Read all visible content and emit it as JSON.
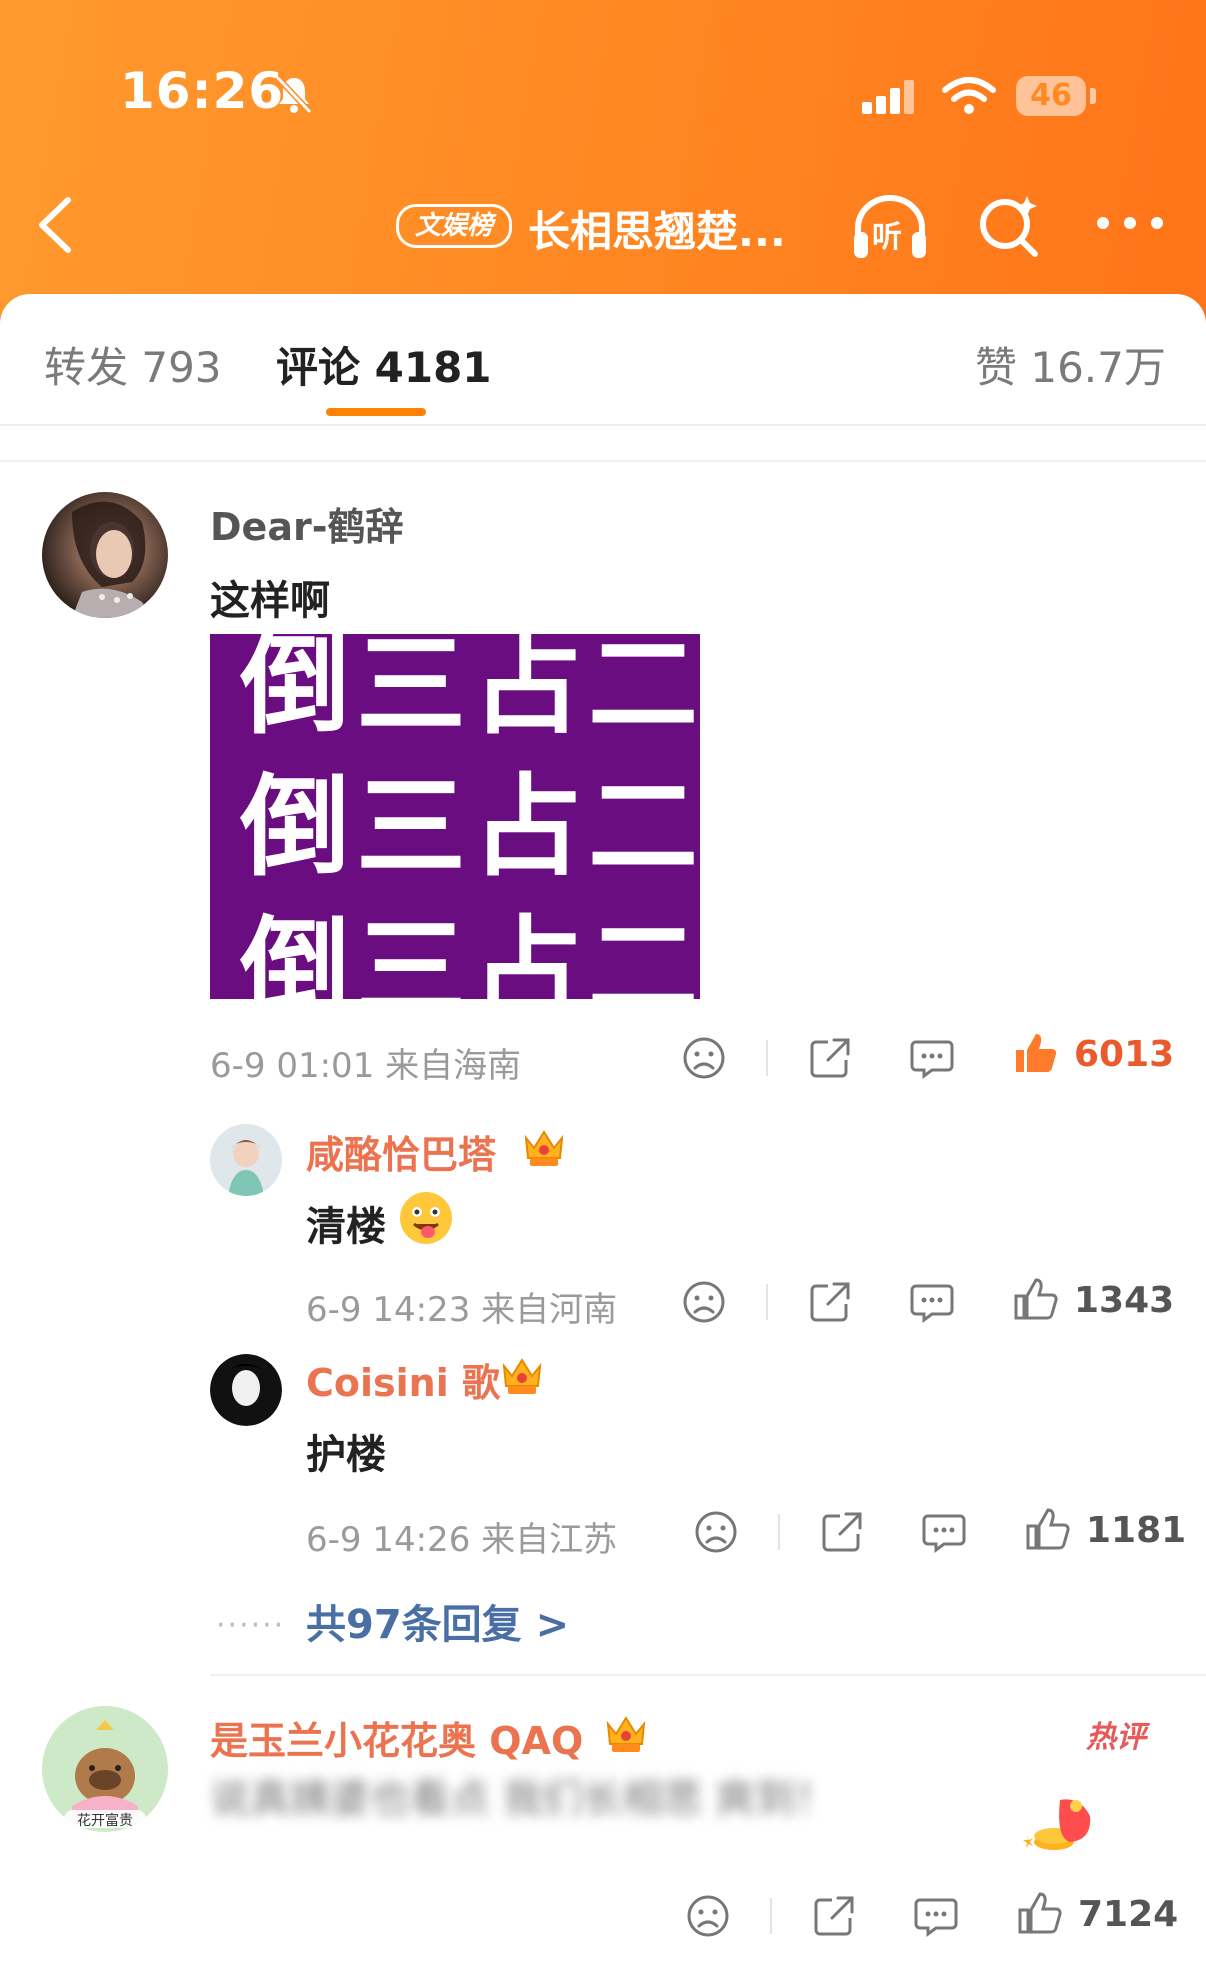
{
  "status_bar": {
    "time": "16:26",
    "battery": "46"
  },
  "nav": {
    "tag": "文娱榜",
    "title": "长相思翘楚...",
    "listen_label": "听"
  },
  "tabs": [
    {
      "label": "转发 793"
    },
    {
      "label": "评论 4181"
    },
    {
      "label": "赞 16.7万"
    }
  ],
  "comments": [
    {
      "username": "Dear-鹤辞",
      "text": "这样啊",
      "image_lines": [
        "倒三占二",
        "倒三占二",
        "倒三占二"
      ],
      "meta": "6-9 01:01 来自海南",
      "likes": "6013"
    }
  ],
  "replies": [
    {
      "username": "咸酪恰巴塔",
      "text": "清楼",
      "meta": "6-9 14:23 来自河南",
      "likes": "1343"
    },
    {
      "username": "Coisini 歌",
      "text": "护楼",
      "meta": "6-9 14:26 来自江苏",
      "likes": "1181"
    }
  ],
  "more_replies": "共97条回复 >",
  "comment2": {
    "username": "是玉兰小花花奥 QAQ",
    "badge": "热评",
    "avatar_text": "花开富贵",
    "text": "说真姨婆也看点 我们长相思 爽到！",
    "likes": "7124"
  },
  "colors": {
    "brand_orange": "#ff8a24",
    "link_blue": "#4a6fa5",
    "name_orange": "#eb7350",
    "hot_like": "#eb5a2c"
  }
}
